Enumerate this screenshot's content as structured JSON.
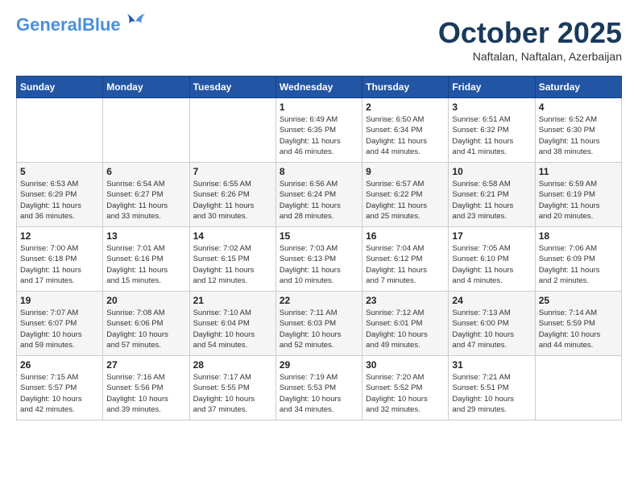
{
  "header": {
    "logo_general": "General",
    "logo_blue": "Blue",
    "month": "October 2025",
    "location": "Naftalan, Naftalan, Azerbaijan"
  },
  "days_of_week": [
    "Sunday",
    "Monday",
    "Tuesday",
    "Wednesday",
    "Thursday",
    "Friday",
    "Saturday"
  ],
  "weeks": [
    [
      {
        "day": "",
        "info": ""
      },
      {
        "day": "",
        "info": ""
      },
      {
        "day": "",
        "info": ""
      },
      {
        "day": "1",
        "info": "Sunrise: 6:49 AM\nSunset: 6:35 PM\nDaylight: 11 hours\nand 46 minutes."
      },
      {
        "day": "2",
        "info": "Sunrise: 6:50 AM\nSunset: 6:34 PM\nDaylight: 11 hours\nand 44 minutes."
      },
      {
        "day": "3",
        "info": "Sunrise: 6:51 AM\nSunset: 6:32 PM\nDaylight: 11 hours\nand 41 minutes."
      },
      {
        "day": "4",
        "info": "Sunrise: 6:52 AM\nSunset: 6:30 PM\nDaylight: 11 hours\nand 38 minutes."
      }
    ],
    [
      {
        "day": "5",
        "info": "Sunrise: 6:53 AM\nSunset: 6:29 PM\nDaylight: 11 hours\nand 36 minutes."
      },
      {
        "day": "6",
        "info": "Sunrise: 6:54 AM\nSunset: 6:27 PM\nDaylight: 11 hours\nand 33 minutes."
      },
      {
        "day": "7",
        "info": "Sunrise: 6:55 AM\nSunset: 6:26 PM\nDaylight: 11 hours\nand 30 minutes."
      },
      {
        "day": "8",
        "info": "Sunrise: 6:56 AM\nSunset: 6:24 PM\nDaylight: 11 hours\nand 28 minutes."
      },
      {
        "day": "9",
        "info": "Sunrise: 6:57 AM\nSunset: 6:22 PM\nDaylight: 11 hours\nand 25 minutes."
      },
      {
        "day": "10",
        "info": "Sunrise: 6:58 AM\nSunset: 6:21 PM\nDaylight: 11 hours\nand 23 minutes."
      },
      {
        "day": "11",
        "info": "Sunrise: 6:59 AM\nSunset: 6:19 PM\nDaylight: 11 hours\nand 20 minutes."
      }
    ],
    [
      {
        "day": "12",
        "info": "Sunrise: 7:00 AM\nSunset: 6:18 PM\nDaylight: 11 hours\nand 17 minutes."
      },
      {
        "day": "13",
        "info": "Sunrise: 7:01 AM\nSunset: 6:16 PM\nDaylight: 11 hours\nand 15 minutes."
      },
      {
        "day": "14",
        "info": "Sunrise: 7:02 AM\nSunset: 6:15 PM\nDaylight: 11 hours\nand 12 minutes."
      },
      {
        "day": "15",
        "info": "Sunrise: 7:03 AM\nSunset: 6:13 PM\nDaylight: 11 hours\nand 10 minutes."
      },
      {
        "day": "16",
        "info": "Sunrise: 7:04 AM\nSunset: 6:12 PM\nDaylight: 11 hours\nand 7 minutes."
      },
      {
        "day": "17",
        "info": "Sunrise: 7:05 AM\nSunset: 6:10 PM\nDaylight: 11 hours\nand 4 minutes."
      },
      {
        "day": "18",
        "info": "Sunrise: 7:06 AM\nSunset: 6:09 PM\nDaylight: 11 hours\nand 2 minutes."
      }
    ],
    [
      {
        "day": "19",
        "info": "Sunrise: 7:07 AM\nSunset: 6:07 PM\nDaylight: 10 hours\nand 59 minutes."
      },
      {
        "day": "20",
        "info": "Sunrise: 7:08 AM\nSunset: 6:06 PM\nDaylight: 10 hours\nand 57 minutes."
      },
      {
        "day": "21",
        "info": "Sunrise: 7:10 AM\nSunset: 6:04 PM\nDaylight: 10 hours\nand 54 minutes."
      },
      {
        "day": "22",
        "info": "Sunrise: 7:11 AM\nSunset: 6:03 PM\nDaylight: 10 hours\nand 52 minutes."
      },
      {
        "day": "23",
        "info": "Sunrise: 7:12 AM\nSunset: 6:01 PM\nDaylight: 10 hours\nand 49 minutes."
      },
      {
        "day": "24",
        "info": "Sunrise: 7:13 AM\nSunset: 6:00 PM\nDaylight: 10 hours\nand 47 minutes."
      },
      {
        "day": "25",
        "info": "Sunrise: 7:14 AM\nSunset: 5:59 PM\nDaylight: 10 hours\nand 44 minutes."
      }
    ],
    [
      {
        "day": "26",
        "info": "Sunrise: 7:15 AM\nSunset: 5:57 PM\nDaylight: 10 hours\nand 42 minutes."
      },
      {
        "day": "27",
        "info": "Sunrise: 7:16 AM\nSunset: 5:56 PM\nDaylight: 10 hours\nand 39 minutes."
      },
      {
        "day": "28",
        "info": "Sunrise: 7:17 AM\nSunset: 5:55 PM\nDaylight: 10 hours\nand 37 minutes."
      },
      {
        "day": "29",
        "info": "Sunrise: 7:19 AM\nSunset: 5:53 PM\nDaylight: 10 hours\nand 34 minutes."
      },
      {
        "day": "30",
        "info": "Sunrise: 7:20 AM\nSunset: 5:52 PM\nDaylight: 10 hours\nand 32 minutes."
      },
      {
        "day": "31",
        "info": "Sunrise: 7:21 AM\nSunset: 5:51 PM\nDaylight: 10 hours\nand 29 minutes."
      },
      {
        "day": "",
        "info": ""
      }
    ]
  ]
}
